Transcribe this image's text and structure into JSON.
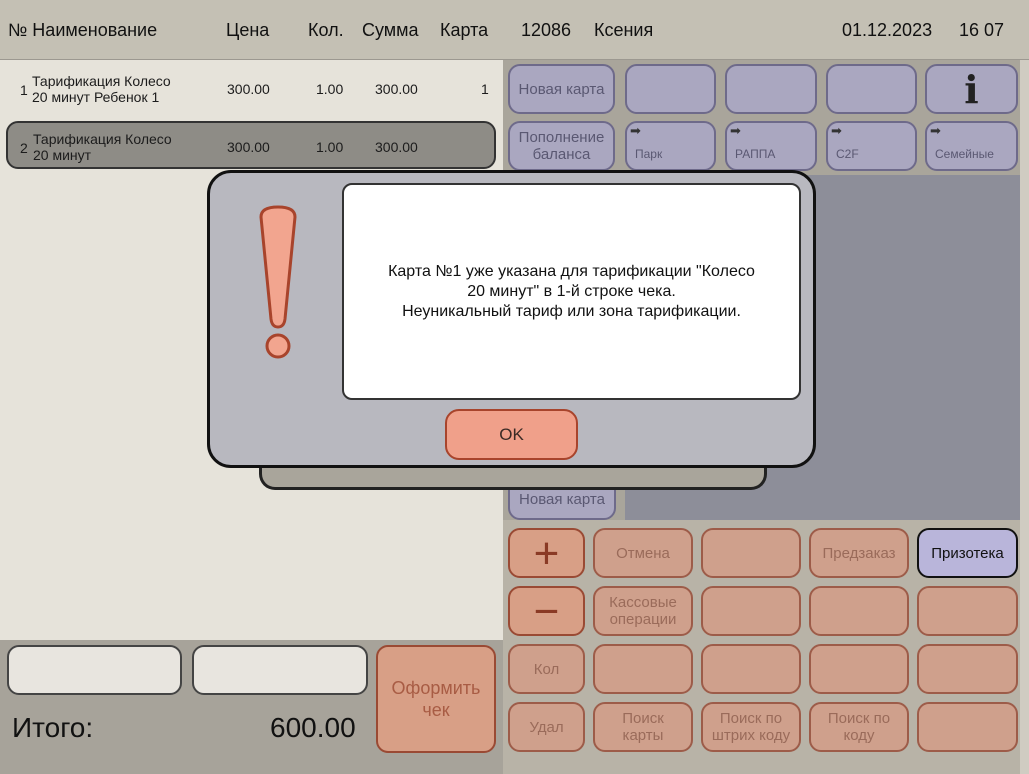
{
  "header": {
    "num_name": "№ Наименование",
    "price": "Цена",
    "qty": "Кол.",
    "sum": "Сумма",
    "card": "Карта",
    "cashier_id": "12086",
    "cashier_name": "Ксения",
    "date": "01.12.2023",
    "time": "16 07"
  },
  "rows": [
    {
      "num": "1",
      "name1": "Тарификация Колесо",
      "name2": "20 минут Ребенок 1",
      "price": "300.00",
      "qty": "1.00",
      "sum": "300.00",
      "card": "1"
    },
    {
      "num": "2",
      "name1": "Тарификация Колесо",
      "name2": "20 минут",
      "price": "300.00",
      "qty": "1.00",
      "sum": "300.00",
      "card": ""
    }
  ],
  "top_buttons": {
    "new_card": "Новая карта",
    "topup1": "Пополнение",
    "topup2": "баланса",
    "park": "Парк",
    "rappa": "РАППА",
    "c2f": "C2F",
    "family": "Семейные",
    "info": "i",
    "new_card_2": "Новая карта"
  },
  "bottom_buttons": {
    "plus": "+",
    "minus": "−",
    "cancel": "Отмена",
    "preorder": "Предзаказ",
    "prizoteka": "Призотека",
    "cash_ops1": "Кассовые",
    "cash_ops2": "операции",
    "qty": "Кол",
    "delete": "Удал",
    "find_card1": "Поиск",
    "find_card2": "карты",
    "find_barcode1": "Поиск по",
    "find_barcode2": "штрих коду",
    "find_code1": "Поиск по",
    "find_code2": "коду",
    "checkout1": "Оформить",
    "checkout2": "чек"
  },
  "totals": {
    "label": "Итого:",
    "value": "600.00"
  },
  "dialog": {
    "line1": "Карта №1 уже указана для тарификации \"Колесо",
    "line2": "20 минут\" в 1-й строке чека.",
    "line3": "Неуникальный тариф или зона тарификации.",
    "ok": "OK"
  },
  "colors": {
    "lavender": "#aaa7c0",
    "orange": "#d89f86",
    "ok_button": "#f0a08a",
    "exclamation": "#f2a58f"
  }
}
